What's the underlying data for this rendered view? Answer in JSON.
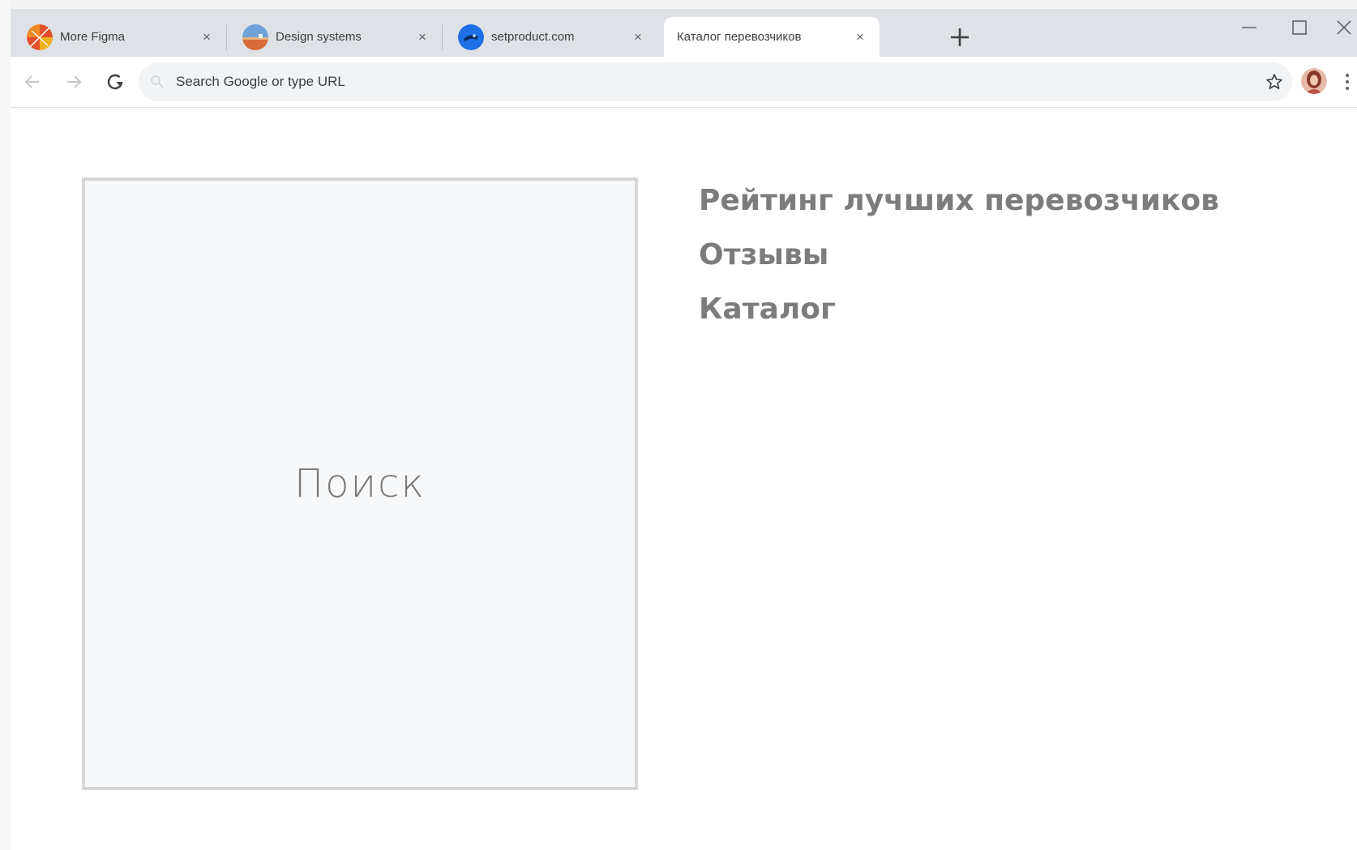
{
  "browser": {
    "tabs": [
      {
        "title": "More Figma",
        "close": "×",
        "icon": "figma-favicon"
      },
      {
        "title": "Design systems",
        "close": "×",
        "icon": "design-systems-favicon"
      },
      {
        "title": "setproduct.com",
        "close": "×",
        "icon": "setproduct-favicon"
      },
      {
        "title": "Каталог перевозчиков",
        "close": "×",
        "icon": "none",
        "active": true
      }
    ],
    "omnibox": {
      "placeholder": "Search Google or type URL",
      "value": ""
    },
    "colors": {
      "tabstrip": "#dee1e6",
      "omnibox": "#f1f3f4",
      "active_tab": "#ffffff"
    }
  },
  "page": {
    "search_block": {
      "label": "Поиск"
    },
    "nav_links": [
      {
        "label": "Рейтинг лучших перевозчиков"
      },
      {
        "label": "Отзывы"
      },
      {
        "label": "Каталог"
      }
    ],
    "colors": {
      "link": "#7c7c7c",
      "search_bg": "#f7f8fa",
      "search_border": "#d6d6d6"
    }
  }
}
